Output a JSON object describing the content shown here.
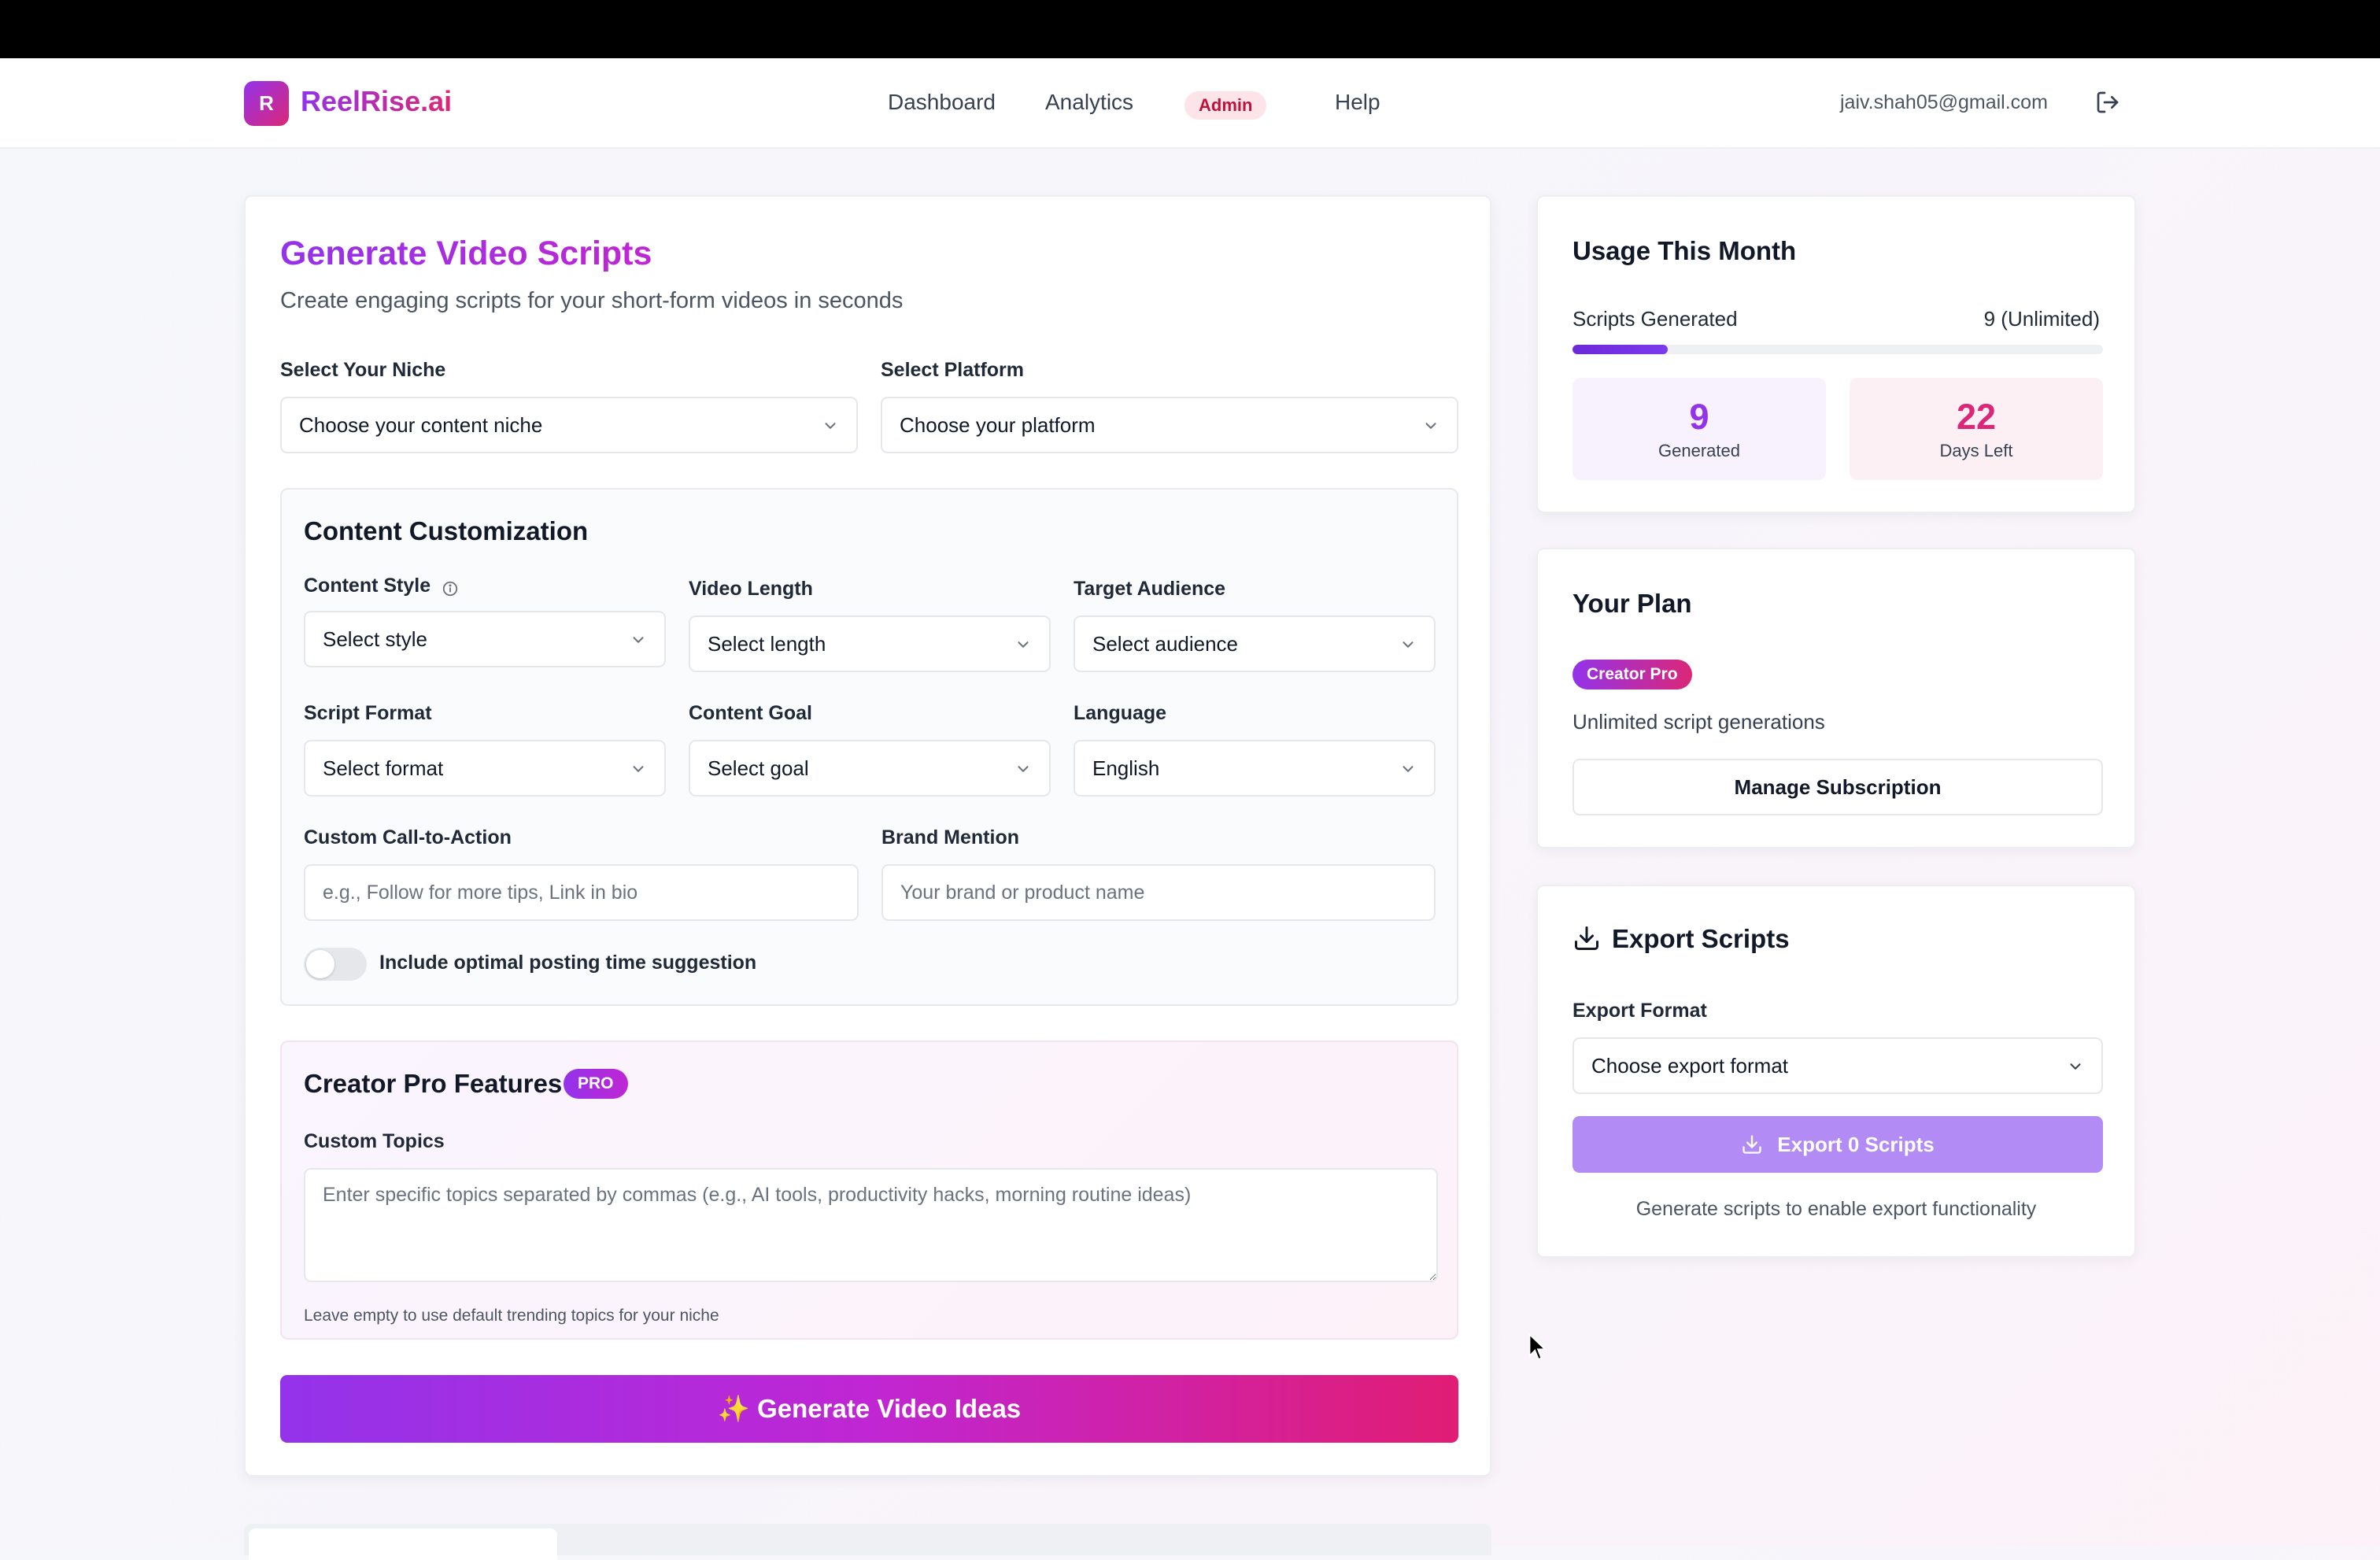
{
  "brand": {
    "logo_letter": "R",
    "name": "ReelRise.ai"
  },
  "nav": {
    "links": [
      "Dashboard",
      "Analytics",
      "Help"
    ],
    "admin_badge": "Admin",
    "user_email": "jaiv.shah05@gmail.com"
  },
  "generator": {
    "title": "Generate Video Scripts",
    "subtitle": "Create engaging scripts for your short-form videos in seconds",
    "niche": {
      "label": "Select Your Niche",
      "value": "Choose your content niche"
    },
    "platform": {
      "label": "Select Platform",
      "value": "Choose your platform"
    },
    "customization": {
      "title": "Content Customization",
      "style": {
        "label": "Content Style",
        "value": "Select style"
      },
      "length": {
        "label": "Video Length",
        "value": "Select length"
      },
      "audience": {
        "label": "Target Audience",
        "value": "Select audience"
      },
      "format": {
        "label": "Script Format",
        "value": "Select format"
      },
      "goal": {
        "label": "Content Goal",
        "value": "Select goal"
      },
      "language": {
        "label": "Language",
        "value": "English"
      },
      "cta": {
        "label": "Custom Call-to-Action",
        "placeholder": "e.g., Follow for more tips, Link in bio",
        "value": ""
      },
      "brand": {
        "label": "Brand Mention",
        "placeholder": "Your brand or product name",
        "value": ""
      },
      "posting_time": {
        "label": "Include optimal posting time suggestion",
        "enabled": false
      }
    },
    "pro": {
      "title": "Creator Pro Features",
      "badge": "PRO",
      "topics_label": "Custom Topics",
      "topics_placeholder": "Enter specific topics separated by commas (e.g., AI tools, productivity hacks, morning routine ideas)",
      "topics_value": "",
      "hint": "Leave empty to use default trending topics for your niche"
    },
    "generate_button": "✨ Generate Video Ideas"
  },
  "usage": {
    "title": "Usage This Month",
    "row_label": "Scripts Generated",
    "row_value": "9 (Unlimited)",
    "progress_percent": 18,
    "generated_count": "9",
    "generated_caption": "Generated",
    "days_left": "22",
    "days_caption": "Days Left",
    "generated_color": "#9333ea",
    "days_color": "#db2777"
  },
  "plan": {
    "title": "Your Plan",
    "badge": "Creator Pro",
    "description": "Unlimited script generations",
    "manage_button": "Manage Subscription"
  },
  "export": {
    "title": "Export Scripts",
    "format_label": "Export Format",
    "format_value": "Choose export format",
    "button": "Export 0 Scripts",
    "note": "Generate scripts to enable export functionality"
  },
  "icons": [
    "logout-icon",
    "chevron-down-icon",
    "info-icon",
    "download-icon",
    "cursor-arrow-icon"
  ]
}
